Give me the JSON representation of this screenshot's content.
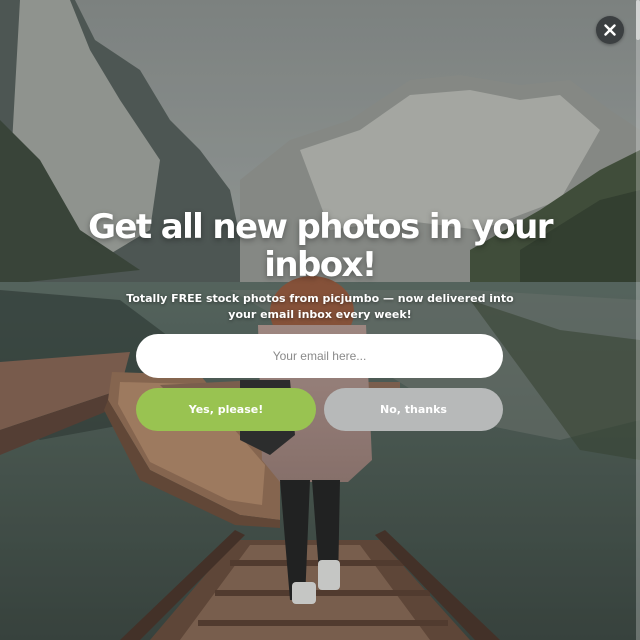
{
  "popup": {
    "headline": "Get all new photos in your inbox!",
    "subtext": "Totally FREE stock photos from picjumbo — now delivered into your email inbox every week!",
    "email_placeholder": "Your email here...",
    "email_value": "",
    "accept_label": "Yes, please!",
    "decline_label": "No, thanks",
    "close_icon": "close-icon"
  },
  "colors": {
    "accept_button": "#99c351",
    "decline_button": "#b7b9b9",
    "close_button": "#3b3f41",
    "text": "#ffffff"
  }
}
